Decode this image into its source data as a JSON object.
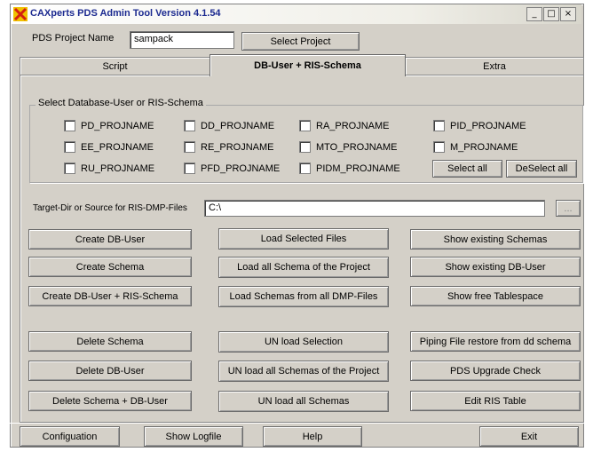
{
  "window": {
    "title": "CAXperts PDS Admin Tool Version 4.1.54",
    "minimize_glyph": "_",
    "maximize_glyph": "□",
    "close_glyph": "×"
  },
  "project": {
    "label": "PDS Project Name",
    "value": "sampack",
    "select_button": "Select Project"
  },
  "tabs": [
    "Script",
    "DB-User + RIS-Schema",
    "Extra"
  ],
  "schema_group": {
    "title": "Select Database-User or RIS-Schema",
    "checkboxes": [
      "PD_PROJNAME",
      "DD_PROJNAME",
      "RA_PROJNAME",
      "PID_PROJNAME",
      "EE_PROJNAME",
      "RE_PROJNAME",
      "MTO_PROJNAME",
      "M_PROJNAME",
      "RU_PROJNAME",
      "PFD_PROJNAME",
      "PIDM_PROJNAME"
    ],
    "select_all": "Select all",
    "deselect_all": "DeSelect all"
  },
  "target": {
    "label": "Target-Dir or Source for RIS-DMP-Files",
    "value": "C:\\",
    "browse_label": "..."
  },
  "actions": {
    "create_db_user": "Create DB-User",
    "create_schema": "Create Schema",
    "create_db_user_ris": "Create DB-User  +  RIS-Schema",
    "load_selected": "Load Selected Files",
    "load_all_schema_project": "Load all Schema of the Project",
    "load_schemas_dmp": "Load  Schemas from all DMP-Files",
    "show_schemas": "Show existing Schemas",
    "show_db_user": "Show existing DB-User",
    "show_tablespace": "Show free Tablespace",
    "delete_schema": "Delete Schema",
    "delete_db_user": "Delete DB-User",
    "delete_schema_db_user": "Delete Schema  +  DB-User",
    "unload_selection": "UN load Selection",
    "unload_all_project": "UN load all Schemas of the Project",
    "unload_all": "UN load all Schemas",
    "piping_restore": "Piping File restore from dd schema",
    "pds_upgrade": "PDS  Upgrade Check",
    "edit_ris": "Edit  RIS Table"
  },
  "footer": {
    "configuration": "Configuation",
    "show_logfile": "Show Logfile",
    "help": "Help",
    "exit": "Exit"
  },
  "colors": {
    "dialog_bg": "#d4d0c8",
    "title_text": "#1c2a90",
    "icon_red": "#d42010",
    "icon_yellow": "#f0c000"
  }
}
